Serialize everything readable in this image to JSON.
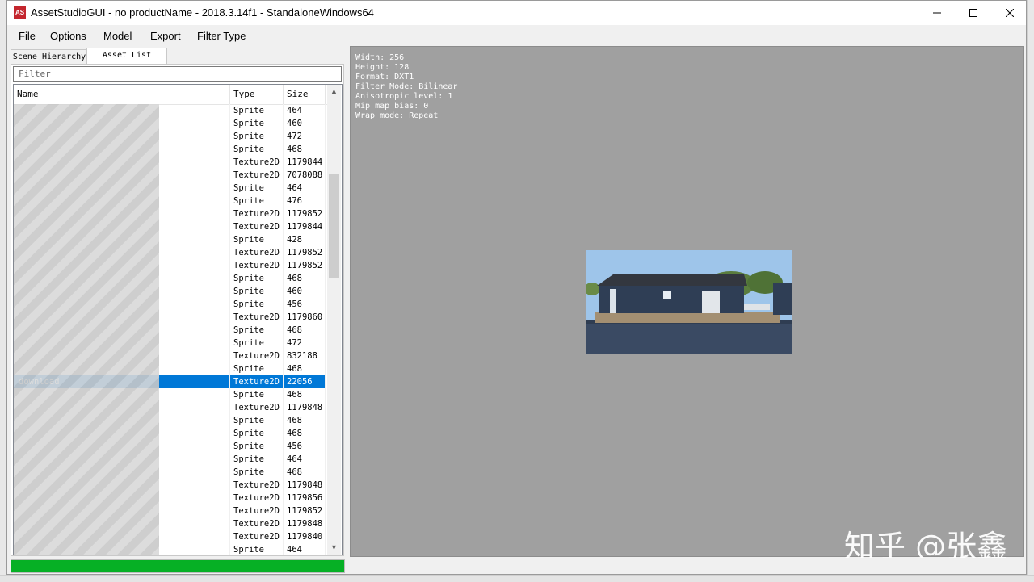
{
  "window": {
    "title": "AssetStudioGUI - no productName - 2018.3.14f1 - StandaloneWindows64",
    "icon_text": "AS",
    "controls": [
      "minimize-icon",
      "maximize-icon",
      "close-icon"
    ]
  },
  "menu": [
    "File",
    "Options",
    "Model",
    "Export",
    "Filter Type"
  ],
  "tabs": [
    "Scene Hierarchy",
    "Asset List"
  ],
  "filter": {
    "placeholder": "Filter",
    "value": ""
  },
  "columns": [
    "Name",
    "Type",
    "Size"
  ],
  "rows": [
    {
      "name": "",
      "type": "Sprite",
      "size": "464"
    },
    {
      "name": "",
      "type": "Sprite",
      "size": "460"
    },
    {
      "name": "",
      "type": "Sprite",
      "size": "472"
    },
    {
      "name": "",
      "type": "Sprite",
      "size": "468"
    },
    {
      "name": "",
      "type": "Texture2D",
      "size": "1179844"
    },
    {
      "name": "",
      "type": "Texture2D",
      "size": "7078088"
    },
    {
      "name": "",
      "type": "Sprite",
      "size": "464"
    },
    {
      "name": "",
      "type": "Sprite",
      "size": "476"
    },
    {
      "name": "",
      "type": "Texture2D",
      "size": "1179852"
    },
    {
      "name": "",
      "type": "Texture2D",
      "size": "1179844"
    },
    {
      "name": "",
      "type": "Sprite",
      "size": "428"
    },
    {
      "name": "",
      "type": "Texture2D",
      "size": "1179852"
    },
    {
      "name": "",
      "type": "Texture2D",
      "size": "1179852"
    },
    {
      "name": "",
      "type": "Sprite",
      "size": "468"
    },
    {
      "name": "",
      "type": "Sprite",
      "size": "460"
    },
    {
      "name": "",
      "type": "Sprite",
      "size": "456"
    },
    {
      "name": "",
      "type": "Texture2D",
      "size": "1179860"
    },
    {
      "name": "",
      "type": "Sprite",
      "size": "468"
    },
    {
      "name": "",
      "type": "Sprite",
      "size": "472"
    },
    {
      "name": "",
      "type": "Texture2D",
      "size": "832188"
    },
    {
      "name": "",
      "type": "Sprite",
      "size": "468"
    },
    {
      "name": "download",
      "type": "Texture2D",
      "size": "22056",
      "selected": true
    },
    {
      "name": "",
      "type": "Sprite",
      "size": "468"
    },
    {
      "name": "",
      "type": "Texture2D",
      "size": "1179848"
    },
    {
      "name": "",
      "type": "Sprite",
      "size": "468"
    },
    {
      "name": "",
      "type": "Sprite",
      "size": "468"
    },
    {
      "name": "",
      "type": "Sprite",
      "size": "456"
    },
    {
      "name": "",
      "type": "Sprite",
      "size": "464"
    },
    {
      "name": "",
      "type": "Sprite",
      "size": "468"
    },
    {
      "name": "",
      "type": "Texture2D",
      "size": "1179848"
    },
    {
      "name": "",
      "type": "Texture2D",
      "size": "1179856"
    },
    {
      "name": "",
      "type": "Texture2D",
      "size": "1179852"
    },
    {
      "name": "",
      "type": "Texture2D",
      "size": "1179848"
    },
    {
      "name": "",
      "type": "Texture2D",
      "size": "1179840"
    },
    {
      "name": "",
      "type": "Sprite",
      "size": "464"
    }
  ],
  "progress": 1.0,
  "preview_info": [
    "Width: 256",
    "Height: 128",
    "Format: DXT1",
    "Filter Mode: Bilinear",
    "Anisotropic level: 1",
    "Mip map bias: 0",
    "Wrap mode: Repeat"
  ],
  "watermark": "知乎 @张鑫",
  "colors": {
    "selection": "#0078d7",
    "progress": "#06b025",
    "preview_bg": "#a0a0a0"
  }
}
